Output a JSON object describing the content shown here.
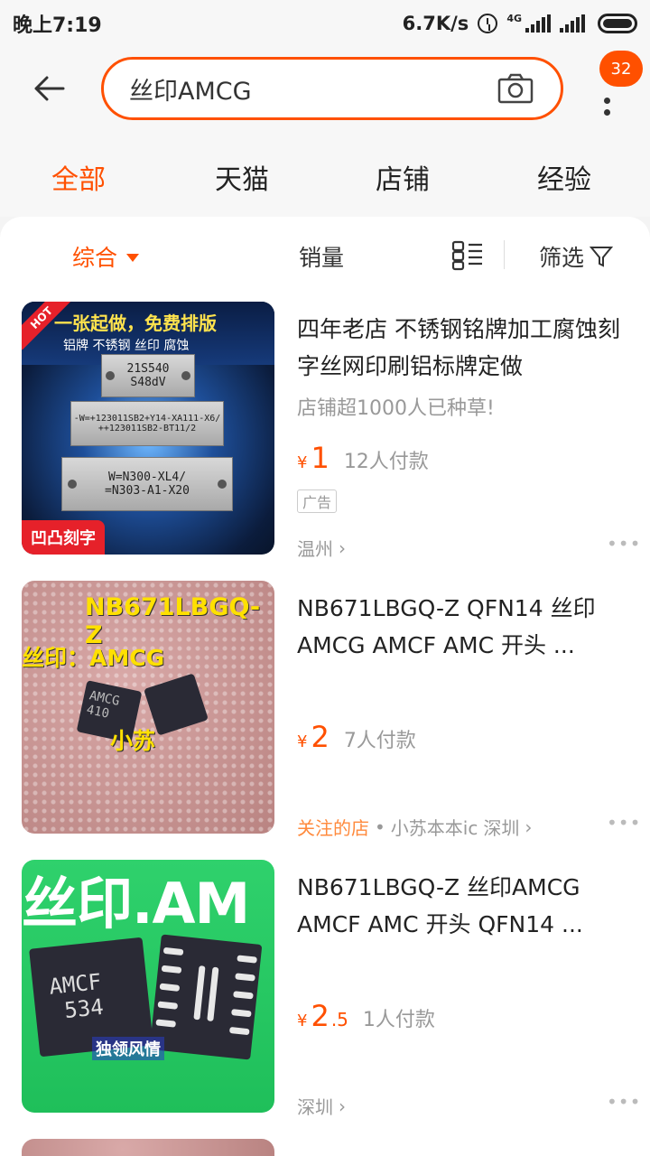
{
  "status_bar": {
    "time": "晚上7:19",
    "speed": "6.7K/s",
    "network": "4G"
  },
  "search": {
    "query": "丝印AMCG",
    "message_badge": "32"
  },
  "tabs": [
    {
      "label": "全部",
      "active": true
    },
    {
      "label": "天猫",
      "active": false
    },
    {
      "label": "店铺",
      "active": false
    },
    {
      "label": "经验",
      "active": false
    }
  ],
  "sort": {
    "comprehensive": "综合",
    "sales": "销量",
    "filter": "筛选"
  },
  "products": [
    {
      "title": "四年老店 不锈钢铭牌加工腐蚀刻字丝网印刷铝标牌定做",
      "subtitle": "店铺超1000人已种草!",
      "currency": "¥",
      "price": "1",
      "paid": "12人付款",
      "ad_tag": "广告",
      "location": "温州",
      "thumb_text": {
        "hot": "HOT",
        "banner_1": "一张起做，免费排版",
        "banner_2": "铝牌 不锈钢 丝印 腐蚀",
        "plate_1_a": "21S540",
        "plate_1_b": "S48dV",
        "plate_2_a": "-W=+123011SB2+Y14-XA111-X6/",
        "plate_2_b": "++123011SB2-BT11/2",
        "plate_3_a": "W=N300-XL4/",
        "plate_3_b": "=N303-A1-X20",
        "corner": "凹凸刻字"
      }
    },
    {
      "title": "NB671LBGQ-Z QFN14 丝印AMCG AMCF AMC 开头 ...",
      "currency": "¥",
      "price": "2",
      "paid": "7人付款",
      "followed_shop": "关注的店",
      "shop": "小苏本本ic",
      "location": "深圳",
      "thumb_text": {
        "part": "NB671LBGQ-Z",
        "mark": "丝印：AMCG",
        "chip_a": "AMCG",
        "chip_b": "410",
        "seller": "小苏"
      }
    },
    {
      "title": "NB671LBGQ-Z 丝印AMCG AMCF AMC 开头 QFN14 ...",
      "currency": "¥",
      "price_int": "2",
      "price_dec": ".5",
      "paid": "1人付款",
      "location": "深圳",
      "thumb_text": {
        "mark": "丝印.AM",
        "chip_a": "AMCF",
        "chip_b": "534",
        "watermark": "独领风情"
      }
    }
  ],
  "colors": {
    "accent": "#ff5000",
    "muted": "#999999",
    "follow": "#ff8a3d"
  }
}
